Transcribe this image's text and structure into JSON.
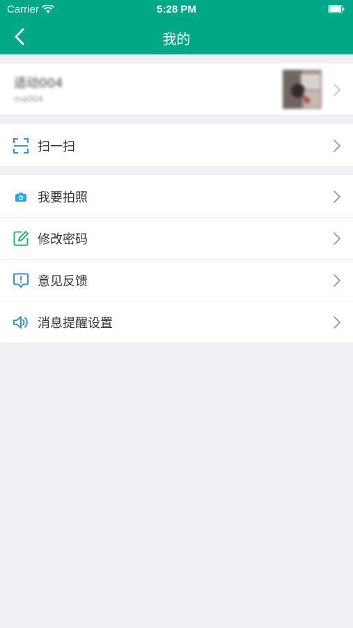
{
  "status_bar": {
    "carrier": "Carrier",
    "time": "5:28 PM"
  },
  "nav": {
    "title": "我的"
  },
  "profile": {
    "name": "适动004",
    "account": "ma004"
  },
  "menu": {
    "scan": {
      "label": "扫一扫",
      "icon": "scan-icon"
    },
    "items": [
      {
        "label": "我要拍照",
        "icon": "camera-icon"
      },
      {
        "label": "修改密码",
        "icon": "edit-icon"
      },
      {
        "label": "意见反馈",
        "icon": "feedback-icon"
      },
      {
        "label": "消息提醒设置",
        "icon": "speaker-icon"
      }
    ]
  },
  "colors": {
    "brand": "#00a887",
    "background": "#efeff4",
    "icon_blue": "#3d8fd8",
    "icon_green": "#2fb36c"
  }
}
